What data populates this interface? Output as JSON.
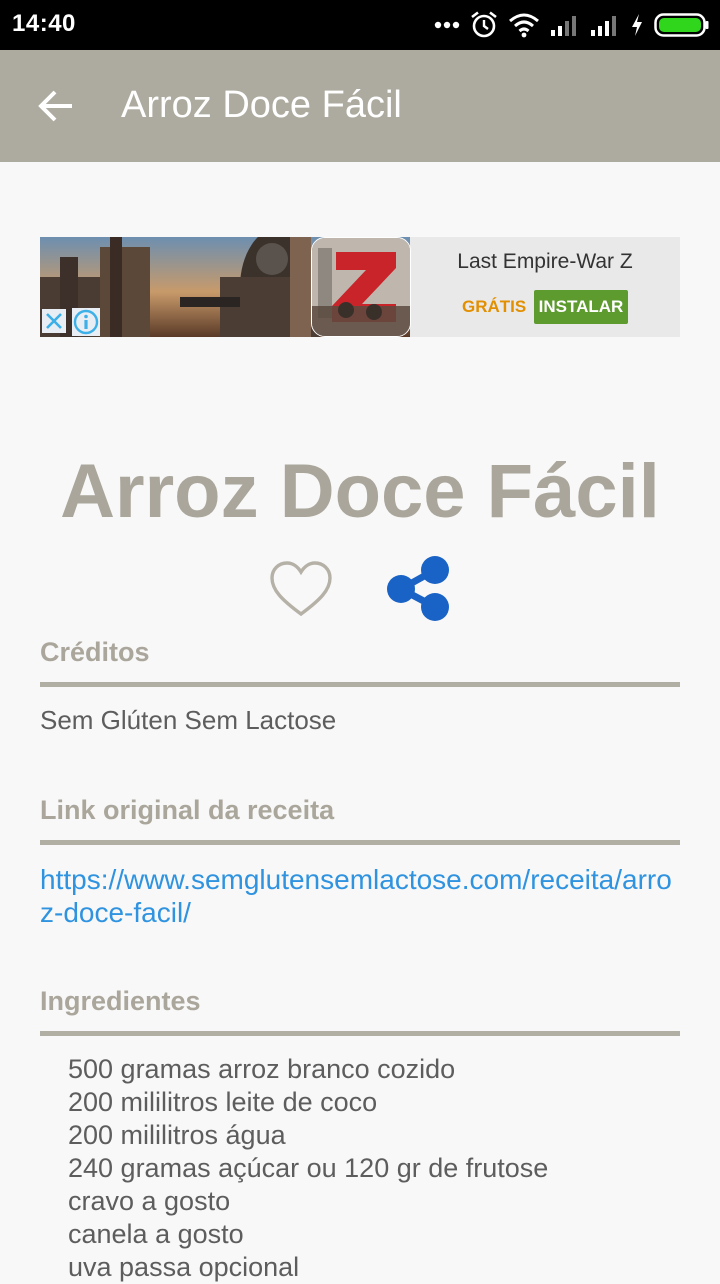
{
  "status_bar": {
    "time": "14:40",
    "icons": [
      "more-dots-icon",
      "alarm-icon",
      "wifi-icon",
      "signal-icon",
      "signal-icon",
      "charging-icon",
      "battery-icon"
    ],
    "battery_color": "#2fd61c"
  },
  "app_bar": {
    "title": "Arroz Doce Fácil",
    "background": "#adaa9f"
  },
  "ad": {
    "app_name": "Last Empire-War Z",
    "price_label": "GRÁTIS",
    "install_label": "INSTALAR"
  },
  "recipe": {
    "title": "Arroz Doce Fácil",
    "accent_color": "#aaa69b",
    "share_color": "#1a63c6"
  },
  "sections": {
    "credits": {
      "heading": "Créditos",
      "text": "Sem Glúten Sem Lactose"
    },
    "link": {
      "heading": "Link original da receita",
      "url": "https://www.semglutensemlactose.com/receita/arroz-doce-facil/"
    },
    "ingredients": {
      "heading": "Ingredientes",
      "items": [
        "500 gramas arroz branco cozido",
        "200 mililitros leite de coco",
        "200 mililitros água",
        "240 gramas açúcar ou 120 gr de frutose",
        "cravo a gosto",
        "canela a gosto",
        "uva passa opcional"
      ]
    }
  }
}
